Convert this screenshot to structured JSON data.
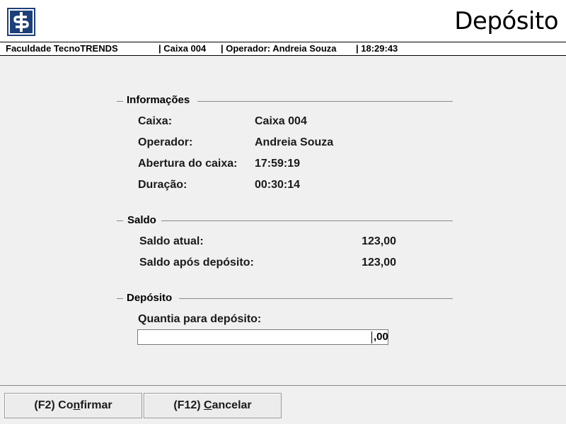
{
  "header": {
    "title": "Depósito",
    "logo_icon": "dollar-sign-icon",
    "brand_color": "#1d3f7a"
  },
  "statusbar": {
    "institution": "Faculdade TecnoTRENDS",
    "register": "| Caixa 004",
    "operator": "| Operador: Andreia Souza",
    "time": "| 18:29:43"
  },
  "info": {
    "title": "Informações",
    "rows": [
      {
        "label": "Caixa:",
        "value": "Caixa 004"
      },
      {
        "label": "Operador:",
        "value": "Andreia Souza"
      },
      {
        "label": "Abertura do caixa:",
        "value": "17:59:19"
      },
      {
        "label": "Duração:",
        "value": "00:30:14"
      }
    ]
  },
  "saldo": {
    "title": "Saldo",
    "rows": [
      {
        "label": "Saldo atual:",
        "value": "123,00"
      },
      {
        "label": "Saldo após depósito:",
        "value": "123,00"
      }
    ]
  },
  "deposito": {
    "title": "Depósito",
    "amount_label": "Quantia para depósito:",
    "amount_value": "",
    "decimals": ",00"
  },
  "footer": {
    "confirm": {
      "pre": "(F2) Co",
      "key": "n",
      "post": "firmar"
    },
    "cancel": {
      "pre": "(F12) ",
      "key": "C",
      "post": "ancelar"
    }
  }
}
